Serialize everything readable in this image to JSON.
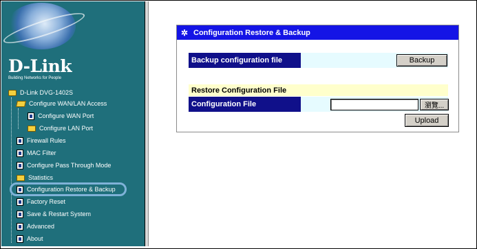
{
  "sidebar": {
    "brand": "D-Link",
    "tagline": "Building Networks for People",
    "items": [
      {
        "label": "D-Link DVG-1402S",
        "icon": "root-folder-icon"
      },
      {
        "label": "Configure WAN/LAN Access",
        "icon": "open-folder-icon"
      },
      {
        "label": "Configure WAN Port",
        "icon": "page-icon"
      },
      {
        "label": "Configure LAN Port",
        "icon": "folder-icon"
      },
      {
        "label": "Firewall Rules",
        "icon": "page-icon"
      },
      {
        "label": "MAC Filter",
        "icon": "page-icon"
      },
      {
        "label": "Configure Pass Through Mode",
        "icon": "page-icon"
      },
      {
        "label": "Statistics",
        "icon": "folder-icon"
      },
      {
        "label": "Configuration Restore & Backup",
        "icon": "page-icon"
      },
      {
        "label": "Factory Reset",
        "icon": "page-icon"
      },
      {
        "label": "Save & Restart System",
        "icon": "page-icon"
      },
      {
        "label": "Advanced",
        "icon": "page-icon"
      },
      {
        "label": "About",
        "icon": "page-icon"
      }
    ]
  },
  "main": {
    "panel_title": "Configuration Restore & Backup",
    "backup": {
      "label": "Backup configuration file",
      "button": "Backup"
    },
    "restore": {
      "section_title": "Restore Configuration File",
      "file_label": "Configuration File",
      "file_value": "",
      "browse_button": "瀏覽...",
      "upload_button": "Upload"
    }
  },
  "colors": {
    "sidebar_bg": "#1f6f7b",
    "header_blue": "#1414e6",
    "label_navy": "#10108a",
    "highlight_ring": "#7fb2d8"
  }
}
